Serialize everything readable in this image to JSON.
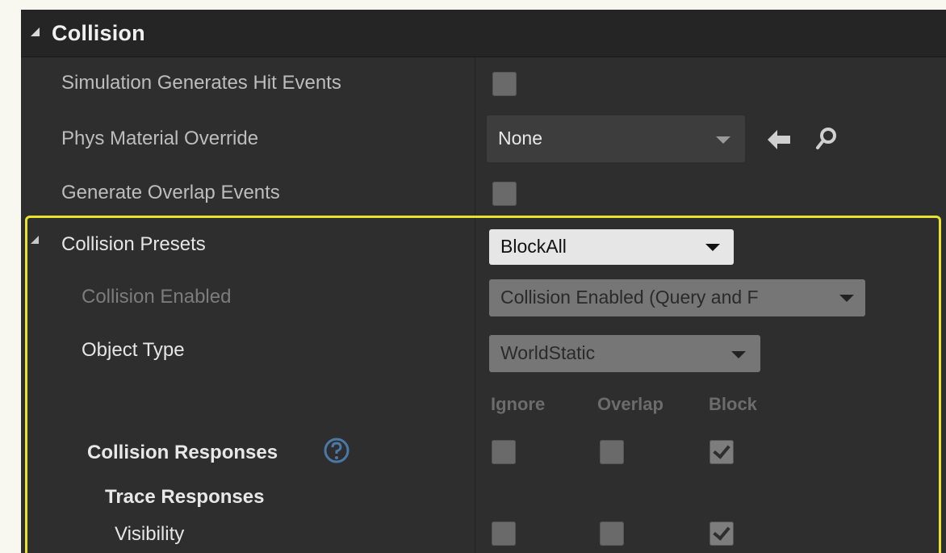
{
  "section": {
    "title": "Collision"
  },
  "properties": {
    "sim_hit_events_label": "Simulation Generates Hit Events",
    "phys_material_label": "Phys Material Override",
    "phys_material_value": "None",
    "gen_overlap_label": "Generate Overlap Events",
    "presets_label": "Collision Presets",
    "presets_value": "BlockAll",
    "collision_enabled_label": "Collision Enabled",
    "collision_enabled_value": "Collision Enabled (Query and F",
    "object_type_label": "Object Type",
    "object_type_value": "WorldStatic",
    "responses_label": "Collision Responses",
    "trace_label": "Trace Responses",
    "visibility_label": "Visibility"
  },
  "response_columns": [
    "Ignore",
    "Overlap",
    "Block"
  ],
  "checkbox_states": {
    "sim_hit_events": false,
    "gen_overlap": false,
    "responses": [
      false,
      false,
      true
    ],
    "visibility": [
      false,
      false,
      true
    ]
  },
  "colors": {
    "panel_bg": "#2e2e2e",
    "highlight_border": "#e8e22a",
    "combo_light": "#e6e6e6"
  },
  "icons": {
    "expand": "triangle-down-right",
    "combo": "chevron-down",
    "use_selected": "left-arrow",
    "browse": "magnifier",
    "help": "question-circle"
  }
}
